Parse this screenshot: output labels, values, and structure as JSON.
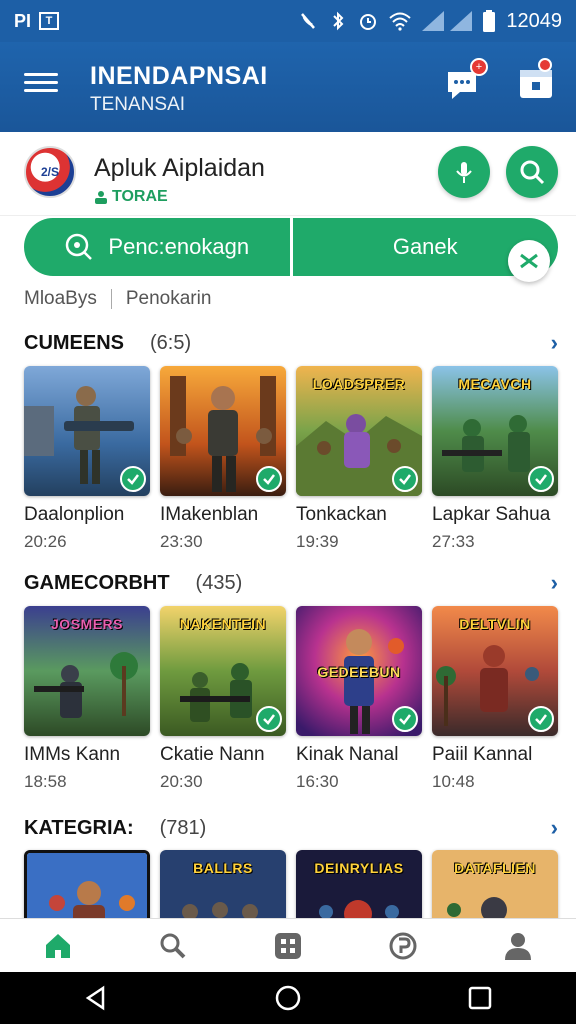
{
  "status_bar": {
    "left_text": "PI",
    "box_text": "T",
    "clock": "12049"
  },
  "app_bar": {
    "title": "INENDAPNSAI",
    "subtitle": "TENANSAI",
    "notif_badge": "+"
  },
  "profile": {
    "logo_text": "2/S",
    "name": "Apluk Aiplaidan",
    "tag": "TORAE"
  },
  "pills": {
    "left_label": "Penc:enokagn",
    "right_label": "Ganek"
  },
  "filters": {
    "first": "MloaBys",
    "second": "Penokarin"
  },
  "sections": [
    {
      "title": "CUMEENS",
      "count": "(6:5)",
      "cards": [
        {
          "name": "Daalonplion",
          "time": "20:26",
          "thumb_text": ""
        },
        {
          "name": "IMakenblan",
          "time": "23:30",
          "thumb_text": ""
        },
        {
          "name": "Tonkackan",
          "time": "19:39",
          "thumb_text": "LOADSPRER"
        },
        {
          "name": "Lapkar Sahua",
          "time": "27:33",
          "thumb_text": "MECAVCH"
        }
      ]
    },
    {
      "title": "GAMECORBHT",
      "count": "(435)",
      "cards": [
        {
          "name": "IMMs Kann",
          "time": "18:58",
          "thumb_text": "JOSMERS"
        },
        {
          "name": "Ckatie Nann",
          "time": "20:30",
          "thumb_text": "NAKENTEIN"
        },
        {
          "name": "Kinak Nanal",
          "time": "16:30",
          "thumb_text": "GEDEEBUN"
        },
        {
          "name": "Paiil Kannal",
          "time": "10:48",
          "thumb_text": "DELTVLIN"
        }
      ]
    },
    {
      "title": "KATEGRIA:",
      "count": "(781)",
      "cards": [
        {
          "thumb_text": ""
        },
        {
          "thumb_text": "BALLRS"
        },
        {
          "thumb_text": "DEINRYLIAS"
        },
        {
          "thumb_text": "DATAFLIEN"
        }
      ]
    }
  ],
  "colors": {
    "primary": "#1d5fa6",
    "accent": "#1faa6a",
    "badge": "#e53935"
  },
  "icons": {
    "status": [
      "mute-icon",
      "bluetooth-icon",
      "alarm-icon",
      "wifi-icon",
      "signal-icon",
      "battery-icon"
    ],
    "app_bar": [
      "menu-icon",
      "chat-notification-icon",
      "calendar-notification-icon"
    ],
    "nav": [
      "home-icon",
      "search-icon",
      "grid-icon",
      "explore-icon",
      "profile-icon"
    ]
  }
}
